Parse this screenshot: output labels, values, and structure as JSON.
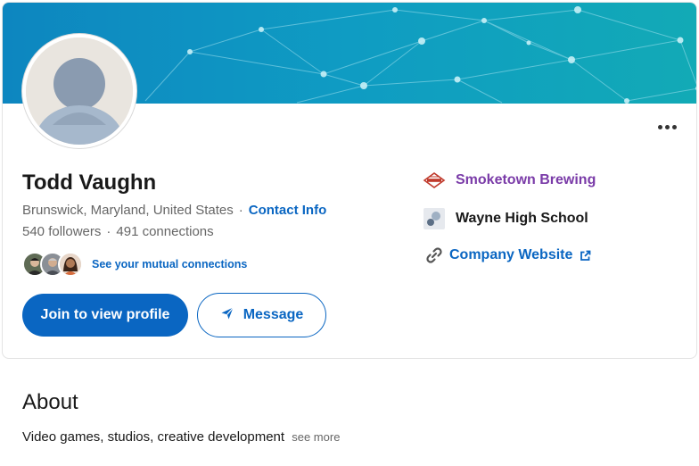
{
  "profile": {
    "name": "Todd Vaughn",
    "location": "Brunswick, Maryland, United States",
    "separator": "·",
    "contact_info_label": "Contact Info",
    "followers": "540 followers",
    "connections": "491 connections",
    "mutual_label": "See your mutual connections",
    "more_menu_icon": "ellipsis-icon"
  },
  "actions": {
    "join_label": "Join to view profile",
    "message_label": "Message",
    "message_icon": "send-icon"
  },
  "sidebar": {
    "company": "Smoketown Brewing",
    "school": "Wayne High School",
    "website_label": "Company Website",
    "website_icon": "link-icon",
    "external_icon": "external-link-icon"
  },
  "about": {
    "title": "About",
    "text": "Video games, studios, creative development",
    "see_more": "see more"
  },
  "colors": {
    "brand_blue": "#0a66c2",
    "company_purple": "#7a3ba8",
    "banner_start": "#0e8fc4",
    "banner_end": "#11a7b4"
  }
}
